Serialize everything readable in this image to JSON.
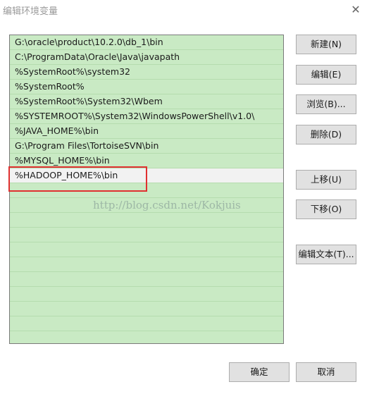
{
  "window": {
    "title": "编辑环境变量",
    "close_glyph": "✕"
  },
  "path_list": {
    "items": [
      "G:\\oracle\\product\\10.2.0\\db_1\\bin",
      "C:\\ProgramData\\Oracle\\Java\\javapath",
      "%SystemRoot%\\system32",
      "%SystemRoot%",
      "%SystemRoot%\\System32\\Wbem",
      "%SYSTEMROOT%\\System32\\WindowsPowerShell\\v1.0\\",
      "%JAVA_HOME%\\bin",
      "G:\\Program Files\\TortoiseSVN\\bin",
      "%MYSQL_HOME%\\bin",
      "%HADOOP_HOME%\\bin"
    ],
    "selected_index": 9
  },
  "watermark": "http://blog.csdn.net/Kokjuis",
  "buttons": {
    "new": "新建(N)",
    "edit": "编辑(E)",
    "browse": "浏览(B)...",
    "delete": "删除(D)",
    "move_up": "上移(U)",
    "move_down": "下移(O)",
    "edit_text": "编辑文本(T)...",
    "ok": "确定",
    "cancel": "取消"
  },
  "colors": {
    "list_background": "#c9eac4",
    "selected_row": "#f2f2f2",
    "annotation_box": "#e03030"
  }
}
